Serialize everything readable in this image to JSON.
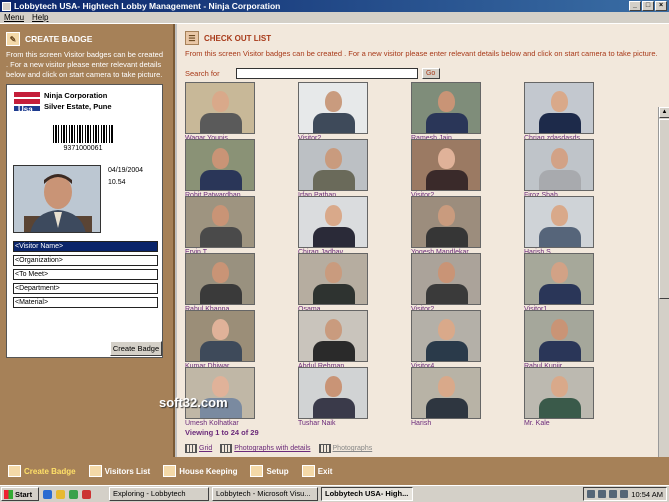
{
  "window": {
    "title": "Lobbytech USA- Hightech Lobby Management - Ninja Corporation",
    "controls": [
      "_",
      "□",
      "×"
    ]
  },
  "menu": [
    "Menu",
    "Help"
  ],
  "create_panel": {
    "heading": "CREATE BADGE",
    "description": "From this screen Visitor badges can be created . For a new visitor please enter relevant details below and click on start camera to take picture.",
    "badge": {
      "company": "Ninja Corporation",
      "location": "Silver Estate, Pune",
      "barcode_number": "9371000061",
      "date": "04/19/2004",
      "time": "10.54",
      "fields": [
        "<Visitor Name>",
        "<Organization>",
        "<To Meet>",
        "<Department>",
        "<Material>"
      ]
    },
    "create_button": "Create Badge"
  },
  "checkout": {
    "heading": "CHECK OUT LIST",
    "description": "From this screen Visitor badges can be created . For a new visitor please enter relevant details below and click on start camera to take picture.",
    "search_label": "Search for",
    "search_value": "",
    "go_label": "Go",
    "visitors": [
      {
        "name": "Waqar Younis",
        "bg": "#c8b898",
        "skin": "#d9a98a",
        "shirt": "#5a5a5a"
      },
      {
        "name": "Visitor2",
        "bg": "#e7e9ea",
        "skin": "#c99b7e",
        "shirt": "#3e4a5a"
      },
      {
        "name": "Ramesh Jain",
        "bg": "#7f8d7a",
        "skin": "#c99476",
        "shirt": "#2a3658"
      },
      {
        "name": "Chriag zdasdasds",
        "bg": "#c3c8cf",
        "skin": "#d9a98a",
        "shirt": "#1d2a4a"
      },
      {
        "name": "Rohit Patwardhan",
        "bg": "#8a9276",
        "skin": "#c99476",
        "shirt": "#2a3658"
      },
      {
        "name": "Irfan Pathan",
        "bg": "#bcc0c4",
        "skin": "#c99b7e",
        "shirt": "#6a6a5a"
      },
      {
        "name": "Visitor2",
        "bg": "#9b7a63",
        "skin": "#e0b299",
        "shirt": "#3a2a2a"
      },
      {
        "name": "Firoz Shah",
        "bg": "#bfc4c9",
        "skin": "#d2a286",
        "shirt": "#a8aaae"
      },
      {
        "name": "Ervin T",
        "bg": "#9e9480",
        "skin": "#c99476",
        "shirt": "#4a4a4a"
      },
      {
        "name": "Chirag Jadhav",
        "bg": "#dadcde",
        "skin": "#d9a98a",
        "shirt": "#2a2a38"
      },
      {
        "name": "Yogesh Mandlekar",
        "bg": "#9c8d7d",
        "skin": "#c99b7e",
        "shirt": "#363636"
      },
      {
        "name": "Harish S",
        "bg": "#cfd3d7",
        "skin": "#d9a98a",
        "shirt": "#56657a"
      },
      {
        "name": "Rahul Khanna",
        "bg": "#99917f",
        "skin": "#c99476",
        "shirt": "#3a3a3a"
      },
      {
        "name": "Osama",
        "bg": "#b6ada0",
        "skin": "#c99b7e",
        "shirt": "#2e3330"
      },
      {
        "name": "Visitor2",
        "bg": "#aba39a",
        "skin": "#c99476",
        "shirt": "#3a3a3a"
      },
      {
        "name": "Visitor1",
        "bg": "#a6a89a",
        "skin": "#d2a286",
        "shirt": "#2a3658"
      },
      {
        "name": "Kumar Dhiwar",
        "bg": "#9b8e78",
        "skin": "#e0b299",
        "shirt": "#3e4a5a"
      },
      {
        "name": "Abdul Rehman",
        "bg": "#c9c4bc",
        "skin": "#c99b7e",
        "shirt": "#2a2a2a"
      },
      {
        "name": "Visitor4",
        "bg": "#b4b0a8",
        "skin": "#d9a98a",
        "shirt": "#2a3a4a"
      },
      {
        "name": "Rahul Kunjir",
        "bg": "#a5a79b",
        "skin": "#c99476",
        "shirt": "#2a3658"
      },
      {
        "name": "Umesh Kolhatkar",
        "bg": "#c0b7a6",
        "skin": "#e0b299",
        "shirt": "#7a8aa0"
      },
      {
        "name": "Tushar Naik",
        "bg": "#d1d3d4",
        "skin": "#c99476",
        "shirt": "#3a3a4a"
      },
      {
        "name": "Harish",
        "bg": "#b8b3a6",
        "skin": "#d9a98a",
        "shirt": "#2e3640"
      },
      {
        "name": "Mr. Kale",
        "bg": "#bcb9b0",
        "skin": "#d9a98a",
        "shirt": "#3a5a4a"
      }
    ],
    "count_text": "Viewing 1 to 24 of 29",
    "view_options": [
      "Grid",
      "Photographs with details",
      "Photographs"
    ]
  },
  "watermark": "soft32.com",
  "toolbar": [
    "Create Badge",
    "Visitors List",
    "House Keeping",
    "Setup",
    "Exit"
  ],
  "taskbar": {
    "start": "Start",
    "tasks": [
      "Exploring - Lobbytech",
      "Lobbytech - Microsoft Visu...",
      "Lobbytech USA- High..."
    ],
    "clock": "10:54 AM"
  }
}
